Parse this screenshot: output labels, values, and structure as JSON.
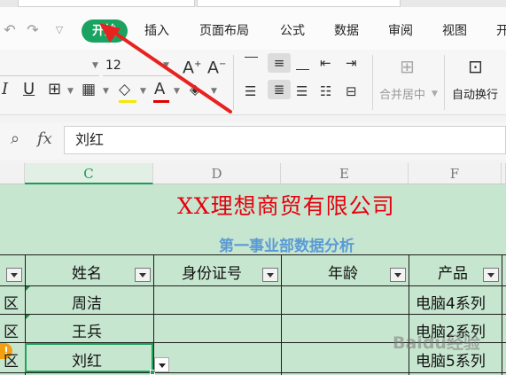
{
  "menu": {
    "tabs": [
      "开始",
      "插入",
      "页面布局",
      "公式",
      "数据",
      "审阅",
      "视图",
      "开"
    ]
  },
  "ribbon": {
    "font_size": "12",
    "merge_center": "合并居中",
    "auto_wrap": "自动换行"
  },
  "formula_bar": {
    "fx": "fx",
    "value": "刘红"
  },
  "columns": [
    "C",
    "D",
    "E",
    "F"
  ],
  "sheet": {
    "title": "XX理想商贸有限公司",
    "subtitle": "第一事业部数据分析",
    "headers": [
      "姓名",
      "身份证号",
      "年龄",
      "产品"
    ],
    "region_fragment": [
      "区",
      "区",
      "区"
    ],
    "rows": [
      {
        "name": "周洁",
        "product": "电脑4系列"
      },
      {
        "name": "王兵",
        "product": "电脑2系列"
      },
      {
        "name": "刘红",
        "product": "电脑5系列"
      }
    ]
  },
  "warning_icon": "!",
  "watermark": "Baidu经验",
  "colors": {
    "accent": "#1aa260",
    "sheet_bg": "#c7e6cf",
    "title": "#e6000e",
    "subtitle": "#5b9bd5",
    "arrow": "#e8221f"
  }
}
